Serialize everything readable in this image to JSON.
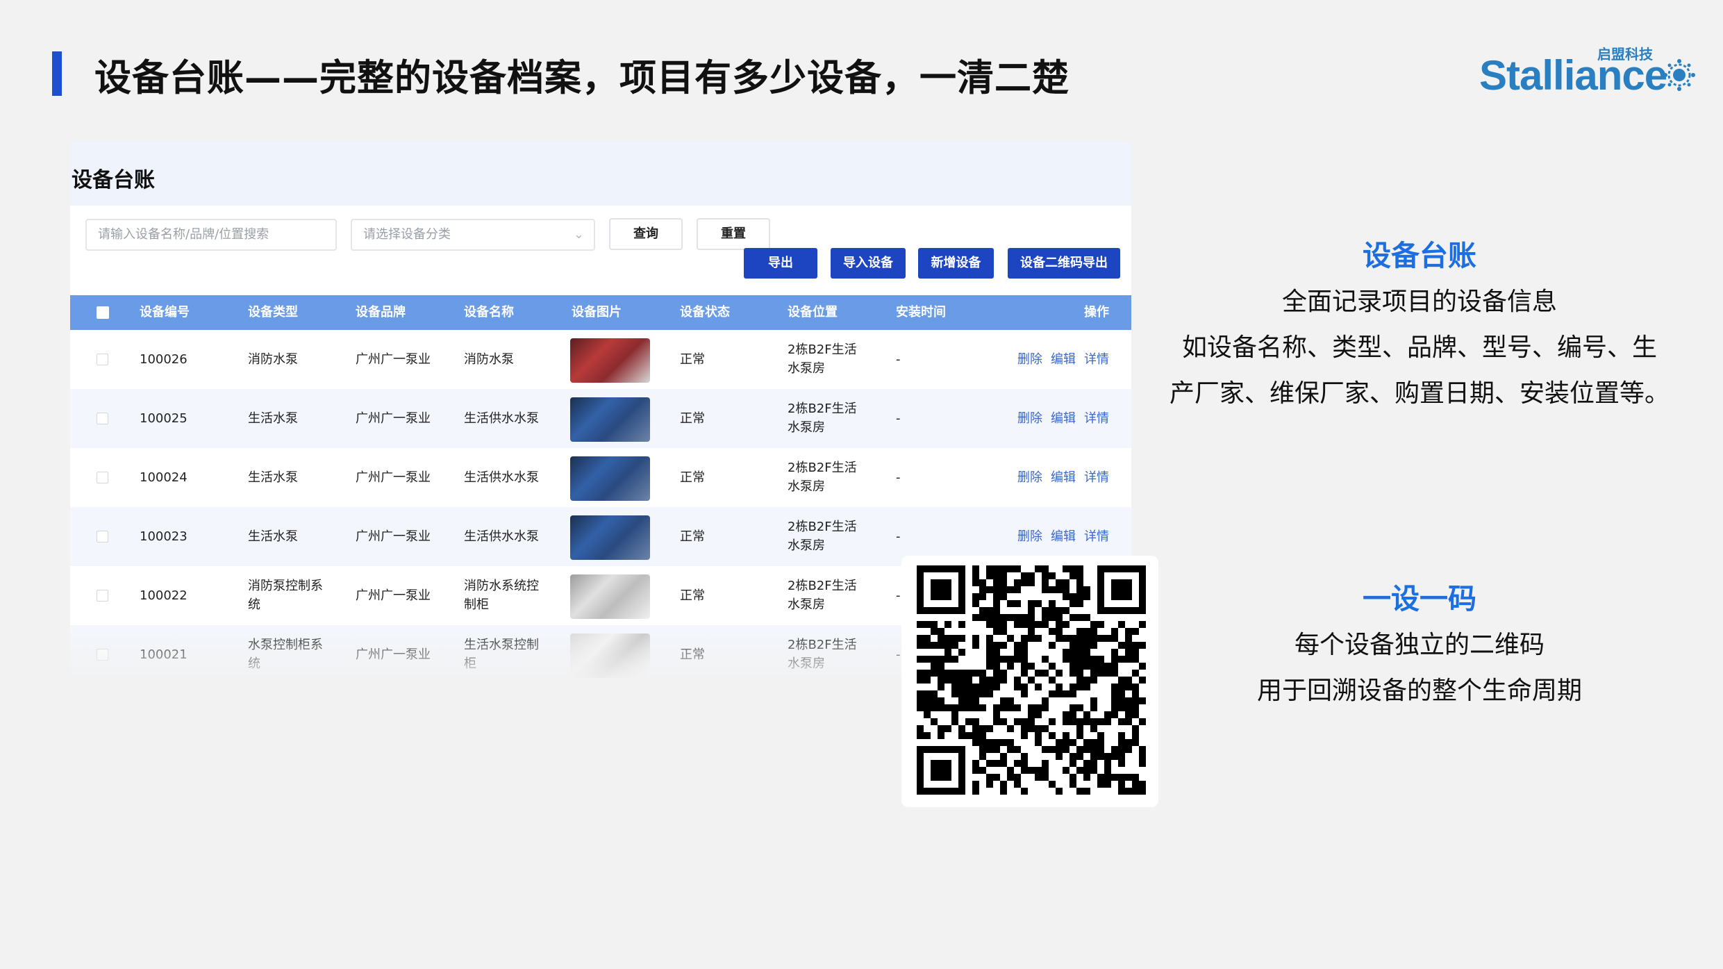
{
  "slide": {
    "title": "设备台账——完整的设备档案，项目有多少设备，一清二楚"
  },
  "logo": {
    "text": "Stalliance",
    "sub": "启盟科技"
  },
  "panel": {
    "title": "设备台账",
    "search_placeholder": "请输入设备名称/品牌/位置搜索",
    "category_placeholder": "请选择设备分类",
    "query_label": "查询",
    "reset_label": "重置",
    "export_label": "导出",
    "import_label": "导入设备",
    "add_label": "新增设备",
    "qr_export_label": "设备二维码导出"
  },
  "table": {
    "columns": [
      "设备编号",
      "设备类型",
      "设备品牌",
      "设备名称",
      "设备图片",
      "设备状态",
      "设备位置",
      "安装时间",
      "操作"
    ],
    "actions": [
      "删除",
      "编辑",
      "详情"
    ],
    "rows": [
      {
        "id": "100026",
        "type": "消防水泵",
        "brand": "广州广一泵业",
        "name": "消防水泵",
        "status": "正常",
        "location": "2栋B2F生活水泵房",
        "install": "-",
        "thumb": "red"
      },
      {
        "id": "100025",
        "type": "生活水泵",
        "brand": "广州广一泵业",
        "name": "生活供水水泵",
        "status": "正常",
        "location": "2栋B2F生活水泵房",
        "install": "-",
        "thumb": "blue"
      },
      {
        "id": "100024",
        "type": "生活水泵",
        "brand": "广州广一泵业",
        "name": "生活供水水泵",
        "status": "正常",
        "location": "2栋B2F生活水泵房",
        "install": "-",
        "thumb": "blue"
      },
      {
        "id": "100023",
        "type": "生活水泵",
        "brand": "广州广一泵业",
        "name": "生活供水水泵",
        "status": "正常",
        "location": "2栋B2F生活水泵房",
        "install": "-",
        "thumb": "blue"
      },
      {
        "id": "100022",
        "type": "消防泵控制系统",
        "brand": "广州广一泵业",
        "name": "消防水系统控制柜",
        "status": "正常",
        "location": "2栋B2F生活水泵房",
        "install": "-",
        "thumb": "grey"
      },
      {
        "id": "100021",
        "type": "水泵控制柜系统",
        "brand": "广州广一泵业",
        "name": "生活水泵控制柜",
        "status": "正常",
        "location": "2栋B2F生活水泵房",
        "install": "-",
        "thumb": "white"
      }
    ]
  },
  "right": {
    "section1": {
      "heading": "设备台账",
      "lines": [
        "全面记录项目的设备信息",
        "如设备名称、类型、品牌、型号、编号、生",
        "产厂家、维保厂家、购置日期、安装位置等。"
      ]
    },
    "section2": {
      "heading": "一设一码",
      "lines": [
        "每个设备独立的二维码",
        "用于回溯设备的整个生命周期"
      ]
    }
  },
  "colors": {
    "accent": "#1d4fd0",
    "header_blue": "#6a9be6",
    "button_blue": "#1d45c2",
    "heading_blue": "#1d6fe0",
    "logo_blue": "#2a7fc1"
  }
}
